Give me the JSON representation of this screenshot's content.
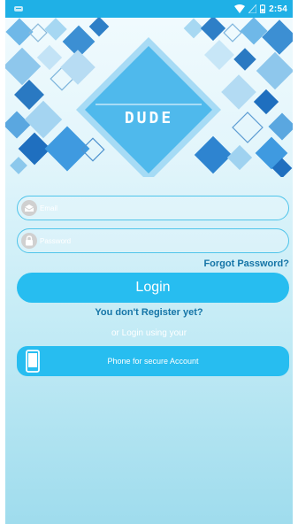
{
  "status_bar": {
    "time": "2:54"
  },
  "logo": {
    "text": "DUDE"
  },
  "email_field": {
    "placeholder": "Email"
  },
  "password_field": {
    "placeholder": "Password"
  },
  "forgot_password": "Forgot Password?",
  "login_button": "Login",
  "register_link": "You don't Register yet?",
  "alt_login_text": "or Login using your",
  "phone_button": "Phone for secure Account",
  "colors": {
    "status_bar": "#1fb0e6",
    "accent": "#27bdf0",
    "link": "#1575a7"
  }
}
